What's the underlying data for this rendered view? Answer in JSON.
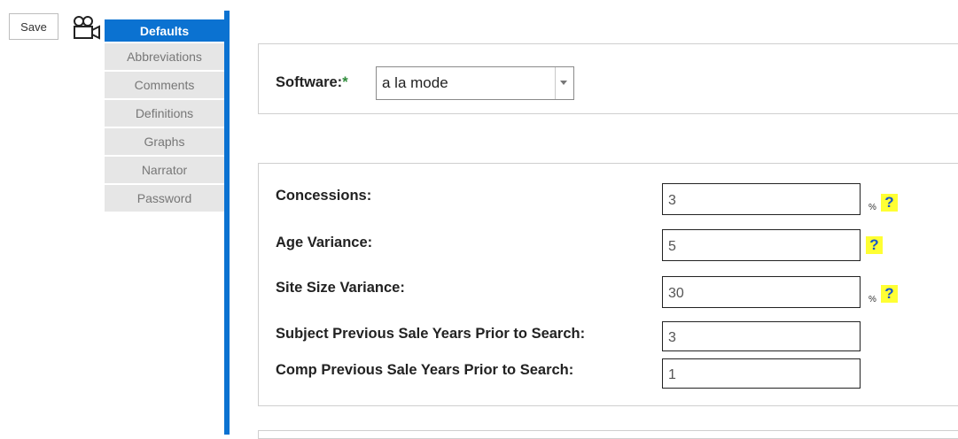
{
  "toolbar": {
    "save_label": "Save",
    "camera_icon": "video-camera-icon"
  },
  "tabs": [
    {
      "label": "Defaults",
      "active": true
    },
    {
      "label": "Abbreviations",
      "active": false
    },
    {
      "label": "Comments",
      "active": false
    },
    {
      "label": "Definitions",
      "active": false
    },
    {
      "label": "Graphs",
      "active": false
    },
    {
      "label": "Narrator",
      "active": false
    },
    {
      "label": "Password",
      "active": false
    }
  ],
  "software": {
    "label": "Software:",
    "required_mark": "*",
    "value": "a la mode"
  },
  "fields": {
    "concessions": {
      "label": "Concessions:",
      "value": "3",
      "unit": "%",
      "help": "?"
    },
    "age_variance": {
      "label": "Age Variance:",
      "value": "5",
      "help": "?"
    },
    "site_size_variance": {
      "label": "Site Size Variance:",
      "value": "30",
      "unit": "%",
      "help": "?"
    },
    "subject_prev_sale": {
      "label": "Subject Previous Sale Years Prior to Search:",
      "value": "3"
    },
    "comp_prev_sale": {
      "label": "Comp Previous Sale Years Prior to Search:",
      "value": "1"
    }
  },
  "colors": {
    "accent": "#0b72d1",
    "required": "#2e8b3a",
    "help_bg": "#ffff33"
  }
}
